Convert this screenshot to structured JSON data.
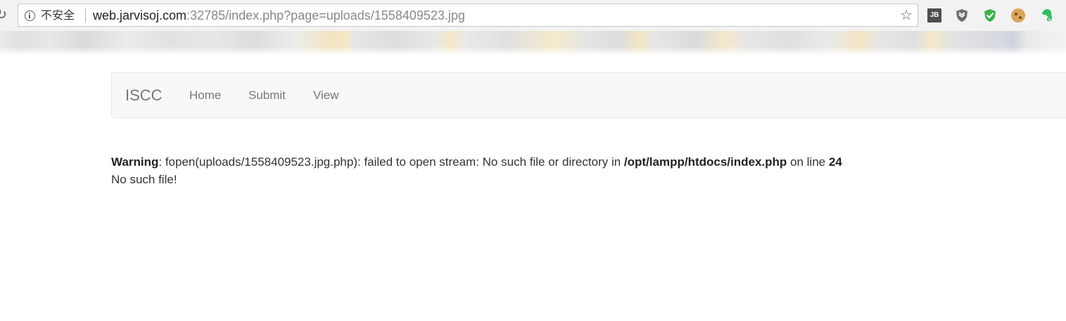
{
  "browser": {
    "security_label": "不安全",
    "url_host": "web.jarvisoj.com",
    "url_rest": ":32785/index.php?page=uploads/1558409523.jpg",
    "extensions": {
      "jb_label": "JB"
    }
  },
  "navbar": {
    "brand": "ISCC",
    "links": [
      "Home",
      "Submit",
      "View"
    ]
  },
  "output": {
    "warning_label": "Warning",
    "warning_text": ": fopen(uploads/1558409523.jpg.php): failed to open stream: No such file or directory in ",
    "file_path": "/opt/lampp/htdocs/index.php",
    "on_line_text": " on line ",
    "line_number": "24",
    "message": "No such file!"
  },
  "colors": {
    "navbar_bg": "#f8f8f8",
    "navbar_text": "#777777",
    "adguard_green": "#3bb34a",
    "evernote_green": "#2dbe60"
  }
}
